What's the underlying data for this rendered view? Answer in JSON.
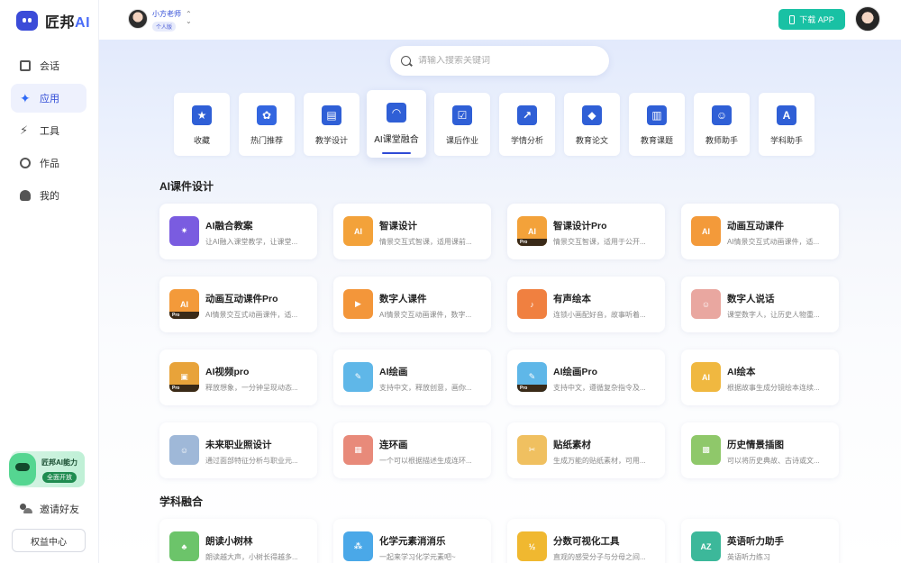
{
  "logo": {
    "text_main": "匠邦",
    "text_ai": "AI"
  },
  "sidebar": {
    "items": [
      {
        "label": "会话",
        "icon": "chat-icon",
        "active": false
      },
      {
        "label": "应用",
        "icon": "sparkle-icon",
        "active": true
      },
      {
        "label": "工具",
        "icon": "lightning-icon",
        "active": false
      },
      {
        "label": "作品",
        "icon": "palette-icon",
        "active": false
      },
      {
        "label": "我的",
        "icon": "user-icon",
        "active": false
      }
    ],
    "promo": {
      "title": "匠邦AI能力",
      "badge": "全面开放"
    },
    "invite_label": "邀请好友",
    "rights_label": "权益中心"
  },
  "user": {
    "name": "小方老师",
    "tag": "个人版"
  },
  "header": {
    "download_label": "下载 APP"
  },
  "search": {
    "placeholder": "请输入搜索关键词"
  },
  "categories": [
    {
      "label": "收藏",
      "icon": "star-icon",
      "color": "#2f5fd6"
    },
    {
      "label": "热门推荐",
      "icon": "sprout-icon",
      "color": "#3366e0"
    },
    {
      "label": "教学设计",
      "icon": "box-icon",
      "color": "#2f5fd6"
    },
    {
      "label": "AI课堂融合",
      "icon": "wifi-screen-icon",
      "color": "#2f5fd6",
      "active": true
    },
    {
      "label": "课后作业",
      "icon": "checklist-icon",
      "color": "#2f5fd6"
    },
    {
      "label": "学情分析",
      "icon": "chart-icon",
      "color": "#2f5fd6"
    },
    {
      "label": "教育论文",
      "icon": "graduation-icon",
      "color": "#2f5fd6"
    },
    {
      "label": "教育课题",
      "icon": "books-icon",
      "color": "#2f5fd6"
    },
    {
      "label": "教师助手",
      "icon": "teacher-icon",
      "color": "#2f5fd6"
    },
    {
      "label": "学科助手",
      "icon": "letter-a-icon",
      "color": "#2f5fd6"
    }
  ],
  "sections": [
    {
      "title": "AI课件设计",
      "cards": [
        {
          "title": "AI融合教案",
          "desc": "让AI融入课堂教学，让课堂...",
          "icon": "book-light-icon",
          "color": "#7a5ce0"
        },
        {
          "title": "智课设计",
          "desc": "情景交互式智课，适用课前...",
          "icon": "ai-screen-icon",
          "color": "#f3a23a"
        },
        {
          "title": "智课设计Pro",
          "desc": "情景交互智课，适用于公开...",
          "icon": "ai-screen-pro-icon",
          "color": "#f3a23a",
          "pro": true
        },
        {
          "title": "动画互动课件",
          "desc": "AI情景交互式动画课件，适...",
          "icon": "ai-board-icon",
          "color": "#f39a3a"
        },
        {
          "title": "动画互动课件Pro",
          "desc": "AI情景交互式动画课件，适...",
          "icon": "ai-board-pro-icon",
          "color": "#f39a3a",
          "pro": true
        },
        {
          "title": "数字人课件",
          "desc": "AI情景交互动画课件，数字...",
          "icon": "play-icon",
          "color": "#f3963a"
        },
        {
          "title": "有声绘本",
          "desc": "连锁小画配好音，故事听着...",
          "icon": "audio-book-icon",
          "color": "#f08040"
        },
        {
          "title": "数字人说话",
          "desc": "课堂数字人，让历史人物重...",
          "icon": "digital-human-icon",
          "color": "#e9a7a0"
        },
        {
          "title": "AI视频pro",
          "desc": "释放想象，一分钟呈现动态...",
          "icon": "clapper-icon",
          "color": "#e8a33a",
          "pro": true
        },
        {
          "title": "AI绘画",
          "desc": "支持中文，释放创意，画你...",
          "icon": "paint-palette-icon",
          "color": "#5fb7e8"
        },
        {
          "title": "AI绘画Pro",
          "desc": "支持中文，遵循复杂指令及...",
          "icon": "paint-palette-pro-icon",
          "color": "#5fb7e8",
          "pro": true
        },
        {
          "title": "AI绘本",
          "desc": "根据故事生成分镜绘本连续...",
          "icon": "picture-book-icon",
          "color": "#f0b840"
        },
        {
          "title": "未来职业照设计",
          "desc": "通过面部特征分析与职业元...",
          "icon": "suit-person-icon",
          "color": "#9fb8d8"
        },
        {
          "title": "连环画",
          "desc": "一个可以根据描述生成连环...",
          "icon": "comic-icon",
          "color": "#e88a7a"
        },
        {
          "title": "贴纸素材",
          "desc": "生成万能的贴纸素材，可用...",
          "icon": "scissors-icon",
          "color": "#f0c060"
        },
        {
          "title": "历史情景插图",
          "desc": "可以将历史典故、古诗或文...",
          "icon": "history-scene-icon",
          "color": "#8fc86a"
        }
      ]
    },
    {
      "title": "学科融合",
      "cards": [
        {
          "title": "朗读小树林",
          "desc": "朗读越大声，小树长得越多...",
          "icon": "tree-icon",
          "color": "#6cc46a"
        },
        {
          "title": "化学元素消消乐",
          "desc": "一起来学习化学元素吧~",
          "icon": "molecule-icon",
          "color": "#4aa8e8"
        },
        {
          "title": "分数可视化工具",
          "desc": "直观的感受分子与分母之间...",
          "icon": "fraction-icon",
          "color": "#f0b830"
        },
        {
          "title": "英语听力助手",
          "desc": "英语听力练习",
          "icon": "headphone-az-icon",
          "color": "#3cb89a"
        }
      ]
    }
  ]
}
